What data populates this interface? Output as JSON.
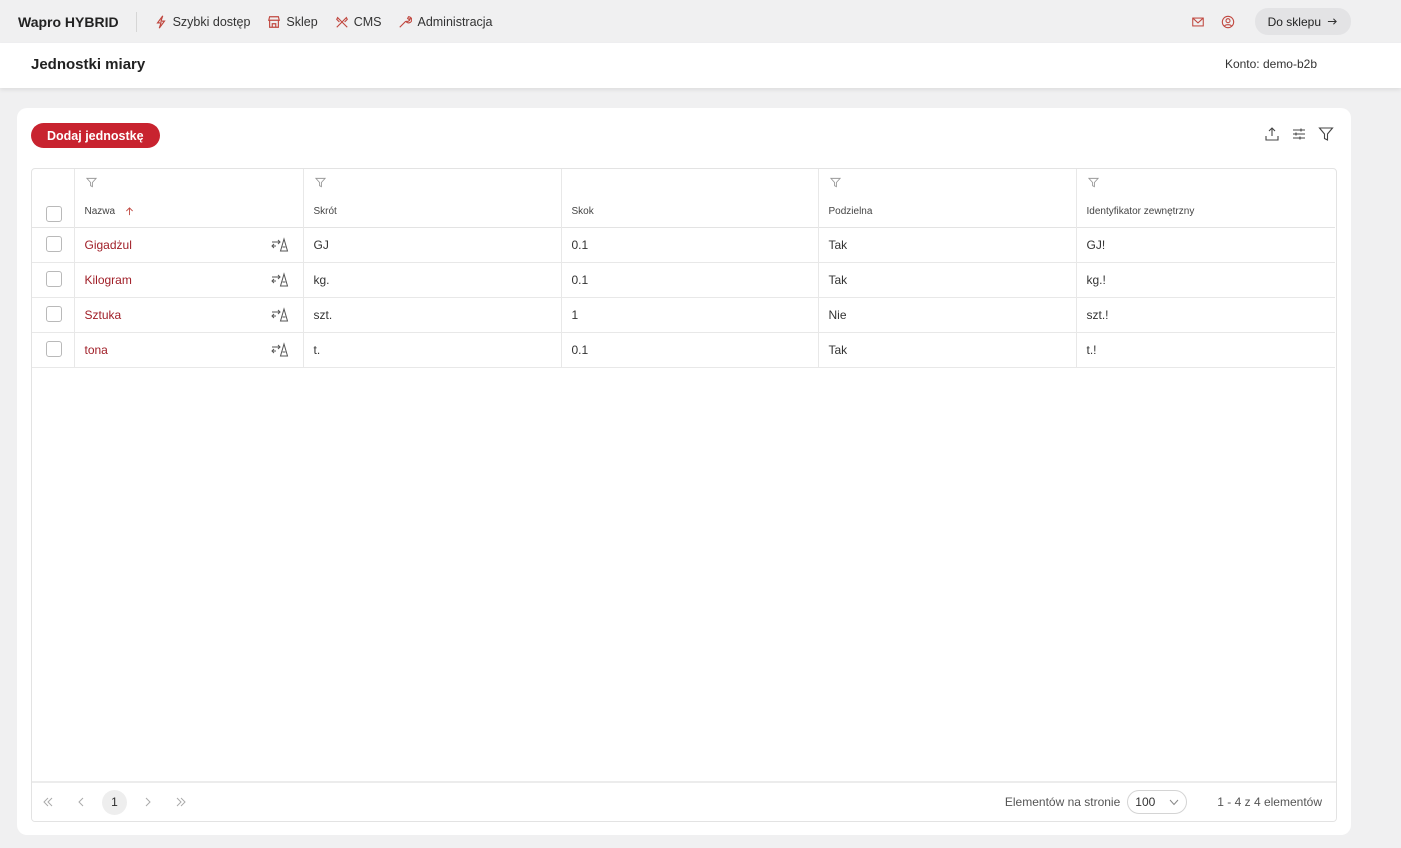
{
  "app": {
    "brand": "Wapro HYBRID",
    "nav": [
      {
        "label": "Szybki dostęp",
        "icon": "lightning-icon"
      },
      {
        "label": "Sklep",
        "icon": "shop-icon"
      },
      {
        "label": "CMS",
        "icon": "tools-icon"
      },
      {
        "label": "Administracja",
        "icon": "wrench-icon"
      }
    ],
    "shop_button": "Do sklepu"
  },
  "header": {
    "title": "Jednostki miary",
    "account": "Konto: demo-b2b"
  },
  "toolbar": {
    "add_label": "Dodaj jednostkę"
  },
  "table": {
    "columns": [
      "Nazwa",
      "Skrót",
      "Skok",
      "Podzielna",
      "Identyfikator zewnętrzny"
    ],
    "rows": [
      {
        "name": "Gigadżul",
        "abbr": "GJ",
        "step": "0.1",
        "divisible": "Tak",
        "ext_id": "GJ!"
      },
      {
        "name": "Kilogram",
        "abbr": "kg.",
        "step": "0.1",
        "divisible": "Tak",
        "ext_id": "kg.!"
      },
      {
        "name": "Sztuka",
        "abbr": "szt.",
        "step": "1",
        "divisible": "Nie",
        "ext_id": "szt.!"
      },
      {
        "name": "tona",
        "abbr": "t.",
        "step": "0.1",
        "divisible": "Tak",
        "ext_id": "t.!"
      }
    ]
  },
  "pager": {
    "page": "1",
    "per_page_label": "Elementów na stronie",
    "per_page_value": "100",
    "summary": "1 - 4 z 4 elementów"
  },
  "colors": {
    "accent": "#c8232f",
    "link": "#a01e27",
    "icon": "#c0473f"
  }
}
